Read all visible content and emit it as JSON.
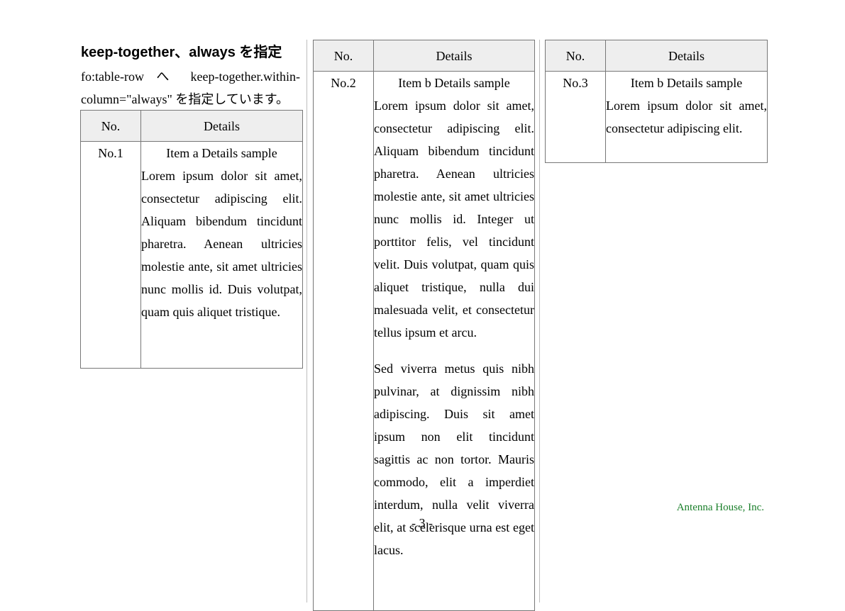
{
  "heading": "keep-together、always を指定",
  "intro": "fo:table-row へ keep-together.within-column=\"always\" を指定しています。",
  "table_headers": {
    "no": "No.",
    "details": "Details"
  },
  "rows": [
    {
      "no": "No.1",
      "title": "Item a Details sample",
      "para1": "Lorem ipsum dolor sit amet, consectetur adipiscing elit. Aliquam bibendum tincidunt pharetra. Aenean ultricies molestie ante, sit amet ultricies nunc mollis id. Duis volutpat, quam quis aliquet tristique."
    },
    {
      "no": "No.2",
      "title": "Item b Details sample",
      "para1": "Lorem ipsum dolor sit amet, consectetur adipiscing elit. Aliquam bibendum tincidunt pharetra. Aenean ultricies molestie ante, sit amet ultricies nunc mollis id. Integer ut porttitor felis, vel tincidunt velit. Duis volutpat, quam quis aliquet tristique, nulla dui malesuada velit, et consectetur tellus ipsum et arcu.",
      "para2": "Sed viverra metus quis nibh pulvinar, at dignissim nibh adipiscing. Duis sit amet ipsum non elit tincidunt sagittis ac non tortor. Mauris commodo, elit a imperdiet interdum, nulla velit viverra elit, at scelerisque urna est eget lacus."
    },
    {
      "no": "No.3",
      "title": "Item b Details sample",
      "para1": "Lorem ipsum dolor sit amet, consectetur adipiscing elit."
    }
  ],
  "footer": {
    "page_number": "- 3 -",
    "company": "Antenna House, Inc."
  }
}
